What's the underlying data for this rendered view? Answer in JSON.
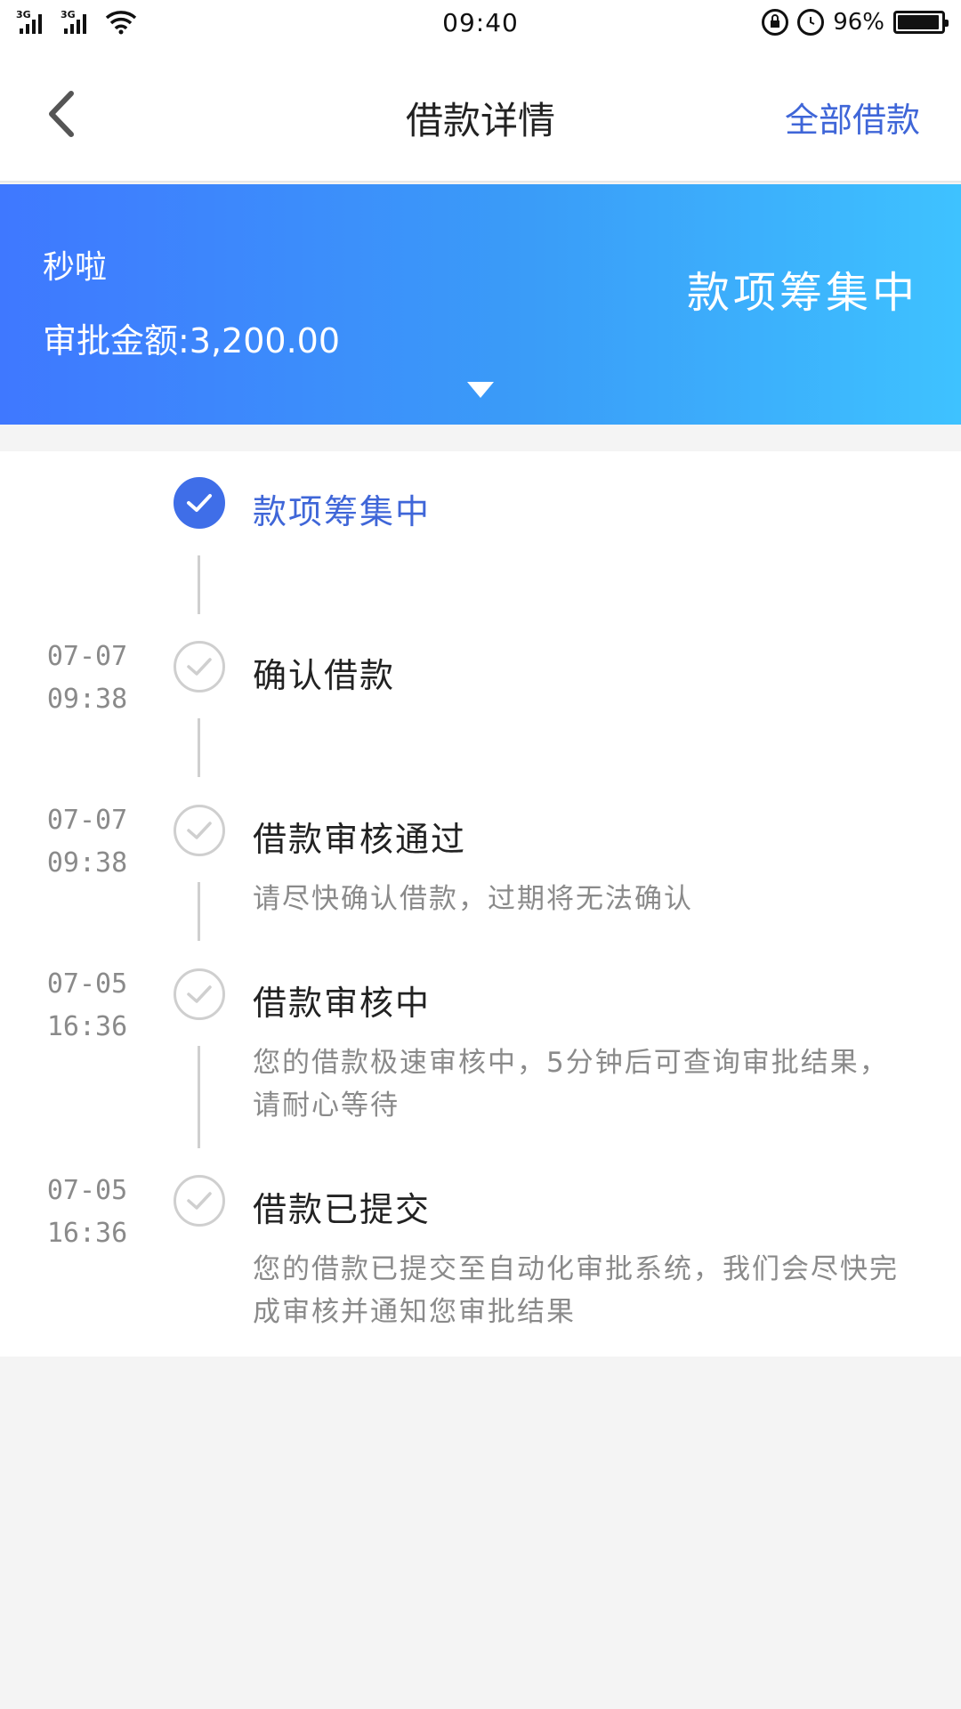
{
  "status_bar": {
    "network_1": "3G",
    "network_2": "3G",
    "time": "09:40",
    "battery": "96%",
    "battery_level": 0.96
  },
  "nav": {
    "title": "借款详情",
    "right_link": "全部借款"
  },
  "banner": {
    "product": "秒啦",
    "amount": "审批金额:3,200.00",
    "status": "款项筹集中"
  },
  "timeline": {
    "steps": [
      {
        "date": "",
        "time": "",
        "title": "款项筹集中",
        "desc": "",
        "active": true
      },
      {
        "date": "07-07",
        "time": "09:38",
        "title": "确认借款",
        "desc": ""
      },
      {
        "date": "07-07",
        "time": "09:38",
        "title": "借款审核通过",
        "desc": "请尽快确认借款，过期将无法确认"
      },
      {
        "date": "07-05",
        "time": "16:36",
        "title": "借款审核中",
        "desc": "您的借款极速审核中，5分钟后可查询审批结果，请耐心等待"
      },
      {
        "date": "07-05",
        "time": "16:36",
        "title": "借款已提交",
        "desc": "您的借款已提交至自动化审批系统，我们会尽快完成审核并通知您审批结果"
      }
    ]
  },
  "colors": {
    "accent": "#3f66d8",
    "banner_start": "#3f78ff",
    "banner_end": "#3ec2ff"
  }
}
